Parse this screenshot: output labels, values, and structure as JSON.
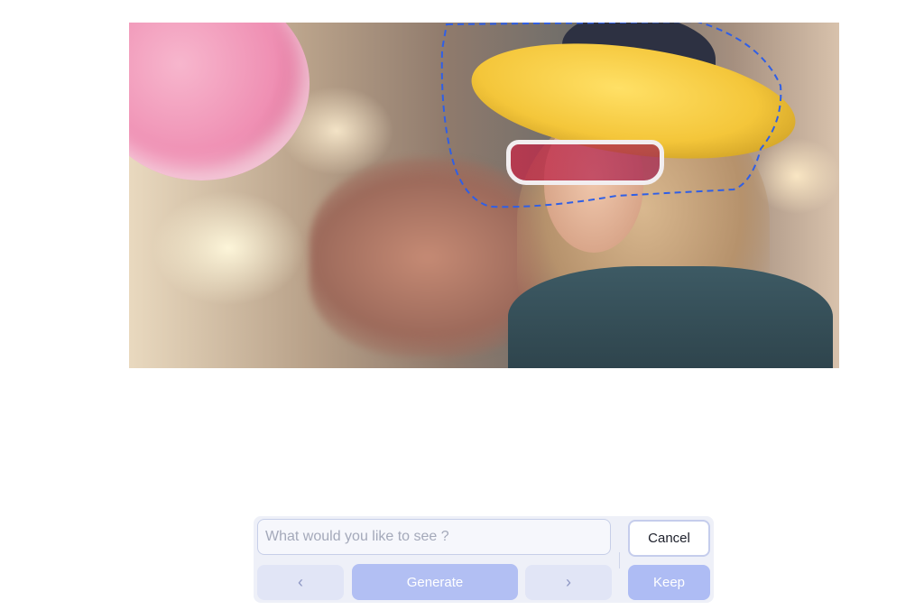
{
  "prompt": {
    "placeholder": "What would you like to see ?",
    "value": ""
  },
  "buttons": {
    "cancel_label": "Cancel",
    "prev_label": "‹",
    "generate_label": "Generate",
    "next_label": "›",
    "keep_label": "Keep"
  },
  "canvas": {
    "selection_style": "dashed",
    "selection_color": "#2f5fe6"
  },
  "colors": {
    "accent": "#aebcf4",
    "panel": "#eef0f8"
  }
}
